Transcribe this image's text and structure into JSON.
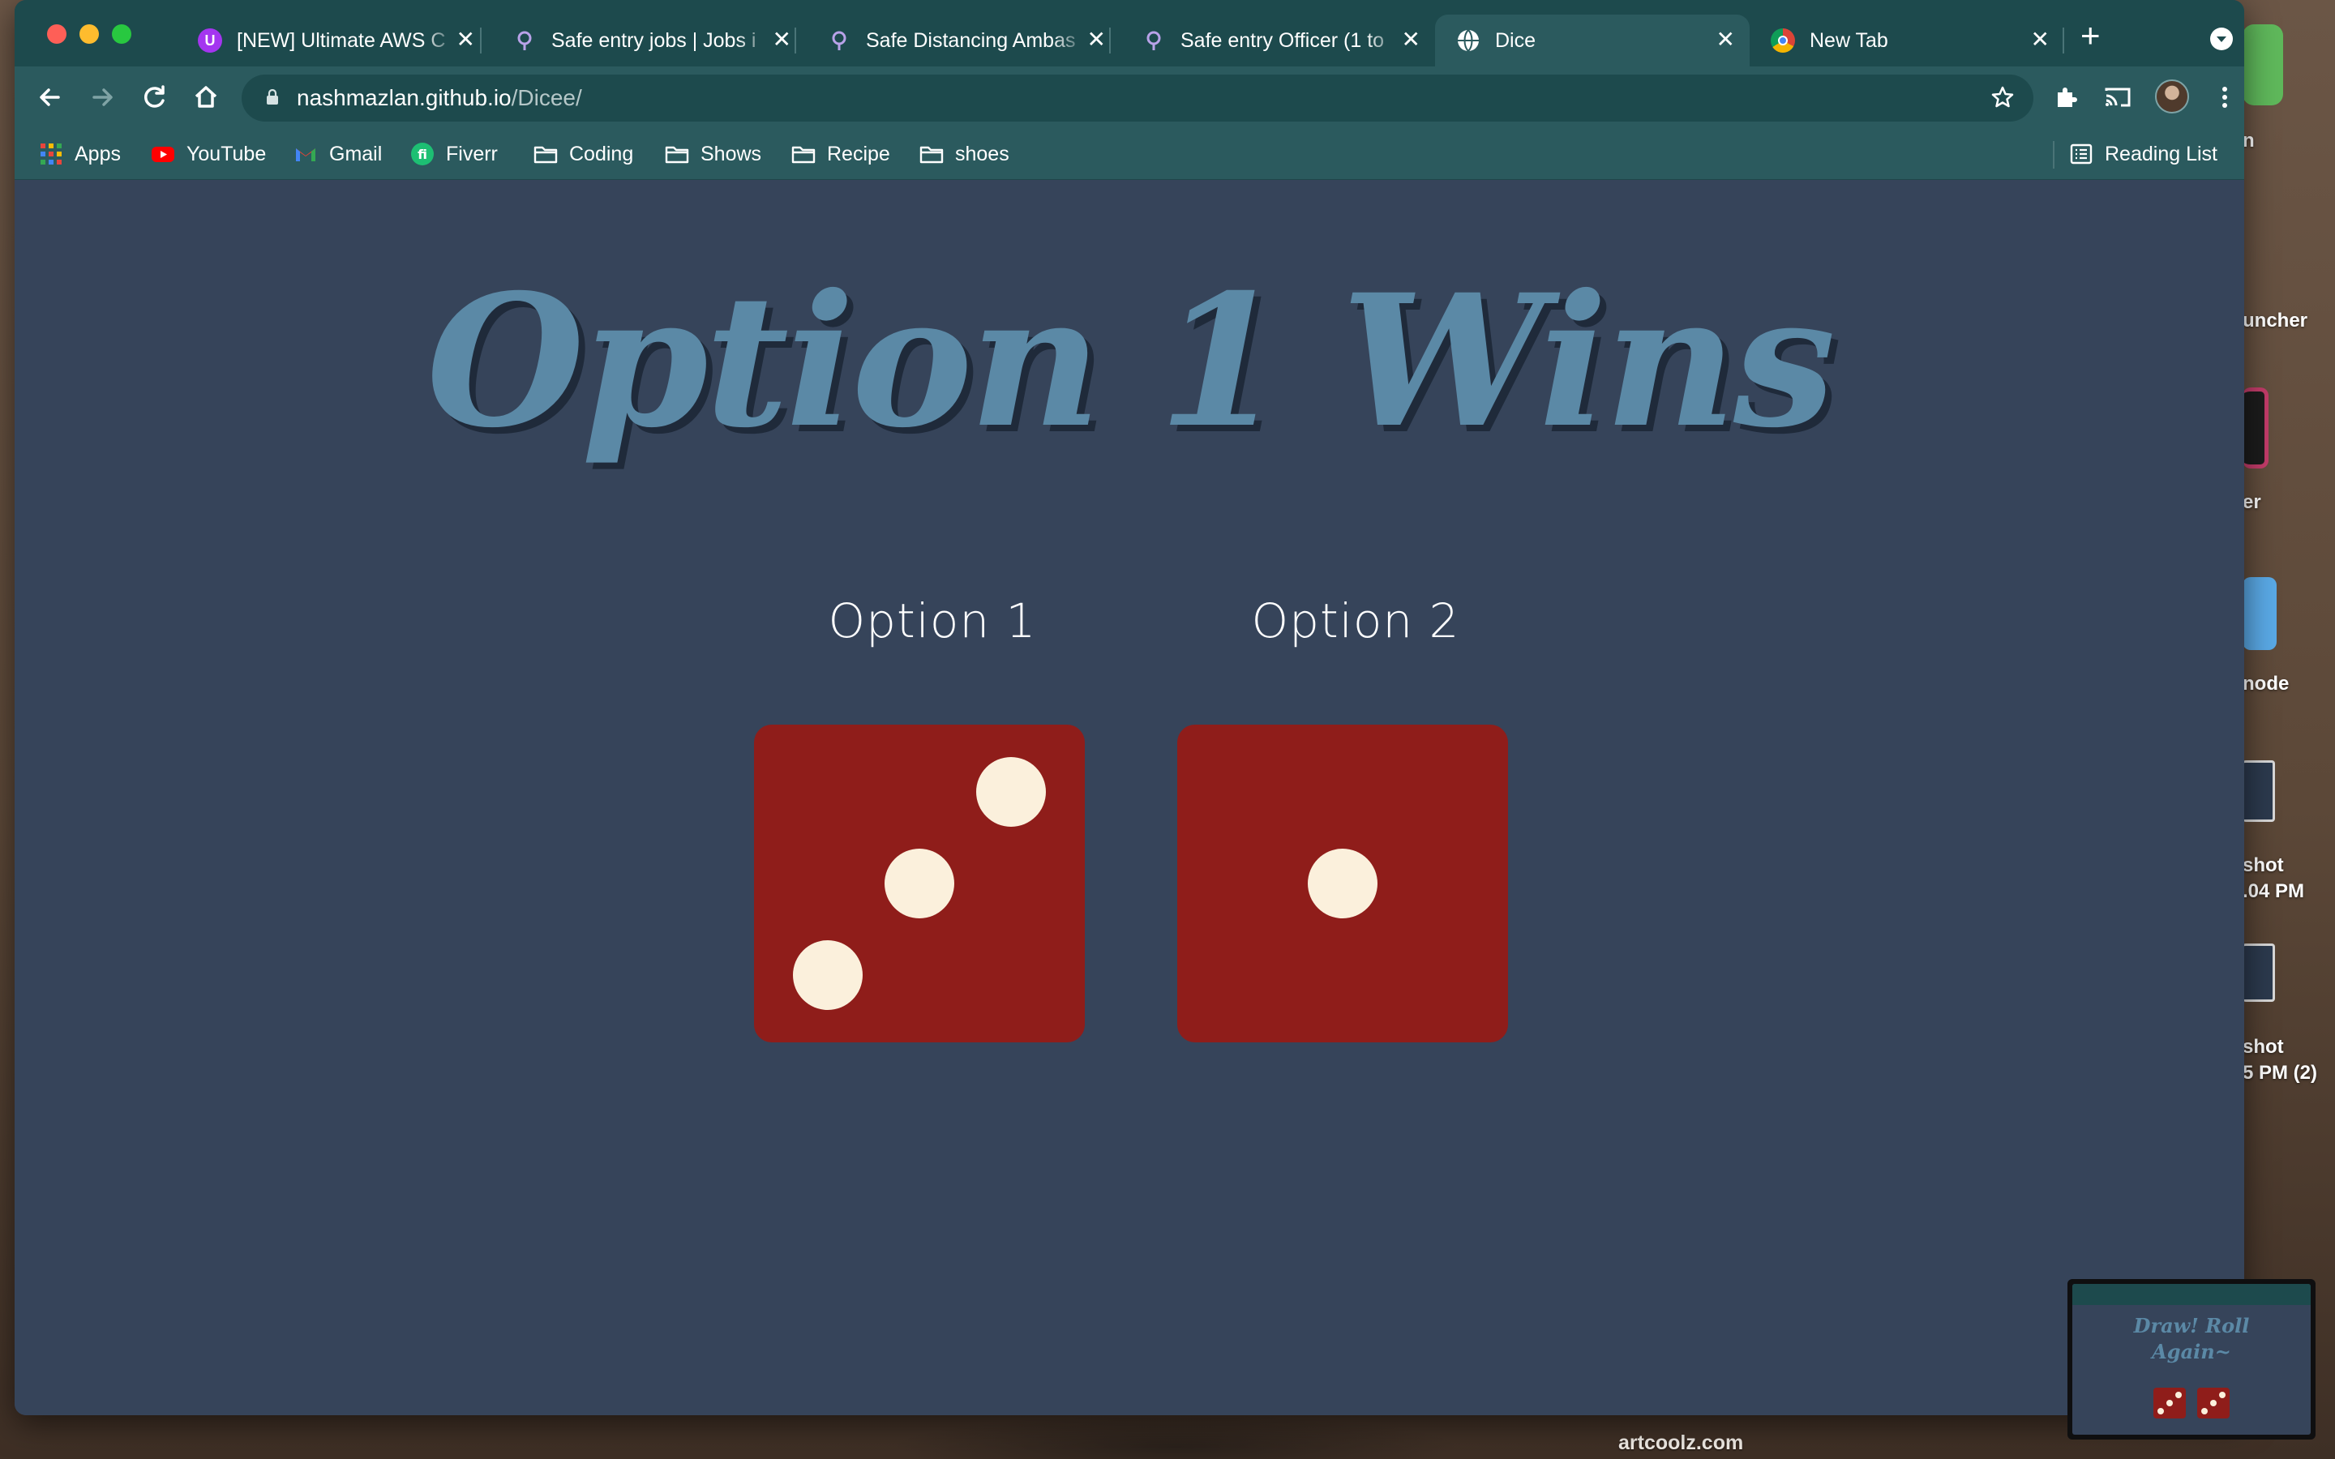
{
  "browser": {
    "tabs": [
      {
        "title": "[NEW] Ultimate AWS C",
        "favicon": "udemy-icon",
        "active": false
      },
      {
        "title": "Safe entry jobs | Jobs i",
        "favicon": "jobs-pin-icon",
        "active": false
      },
      {
        "title": "Safe Distancing Ambas",
        "favicon": "jobs-pin-icon",
        "active": false
      },
      {
        "title": "Safe entry Officer (1 to",
        "favicon": "jobs-pin-icon",
        "active": false
      },
      {
        "title": "Dice",
        "favicon": "globe-icon",
        "active": true
      },
      {
        "title": "New Tab",
        "favicon": "chrome-icon",
        "active": false
      }
    ],
    "address_bar": {
      "domain": "nashmazlan.github.io",
      "path": "/Dicee/"
    },
    "bookmarks": [
      "Apps",
      "YouTube",
      "Gmail",
      "Fiverr",
      "Coding",
      "Shows",
      "Recipe",
      "shoes"
    ],
    "reading_list_label": "Reading List"
  },
  "page": {
    "headline": "Option 1 Wins",
    "player1_label": "Option 1",
    "player2_label": "Option 2",
    "player1_roll": 3,
    "player2_roll": 1,
    "die_color": "#8f1d1a",
    "pip_color": "#fbf0dc",
    "headline_color": "#5b89a6",
    "background_color": "#36445a"
  },
  "desktop": {
    "labels": [
      "n",
      "uncher",
      "er",
      "node",
      "shot",
      ".04 PM",
      "shot",
      "5 PM (2)"
    ],
    "watermark": "artcoolz.com"
  },
  "preview_thumbnail": {
    "title_line1": "Draw! Roll",
    "title_line2": "Again~",
    "dice": [
      3,
      3
    ]
  }
}
